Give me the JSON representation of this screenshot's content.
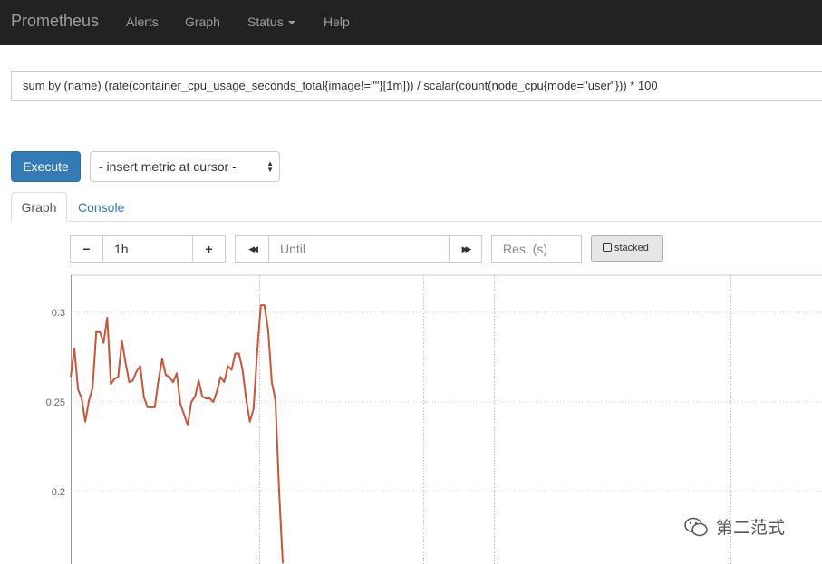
{
  "navbar": {
    "brand": "Prometheus",
    "items": [
      {
        "label": "Alerts"
      },
      {
        "label": "Graph"
      },
      {
        "label": "Status"
      },
      {
        "label": "Help"
      }
    ]
  },
  "query": {
    "expression": "sum by (name) (rate(container_cpu_usage_seconds_total{image!=\"\"}[1m])) / scalar(count(node_cpu{mode=\"user\"})) * 100"
  },
  "actions": {
    "execute_label": "Execute",
    "insert_metric_label": "- insert metric at cursor -"
  },
  "tabs": [
    {
      "label": "Graph",
      "active": true
    },
    {
      "label": "Console",
      "active": false
    }
  ],
  "controls": {
    "range_minus": "−",
    "range_value": "1h",
    "range_plus": "+",
    "back_icon": "◀◀",
    "until_placeholder": "Until",
    "forward_icon": "▶▶",
    "resolution_placeholder": "Res. (s)",
    "stacked_label": "stacked"
  },
  "colors": {
    "series": "#c8553a",
    "navbar_bg": "#222222",
    "primary": "#337ab7",
    "link": "#337ab7"
  },
  "chart_data": {
    "type": "line",
    "y_ticks": [
      "0.3",
      "0.25",
      "0.2"
    ],
    "ylim": [
      0.16,
      0.32
    ],
    "grid": true,
    "series": [
      {
        "values": [
          0.264,
          0.28,
          0.257,
          0.252,
          0.239,
          0.251,
          0.258,
          0.289,
          0.289,
          0.283,
          0.297,
          0.26,
          0.263,
          0.264,
          0.284,
          0.272,
          0.261,
          0.262,
          0.267,
          0.27,
          0.253,
          0.247,
          0.247,
          0.247,
          0.262,
          0.274,
          0.265,
          0.264,
          0.261,
          0.266,
          0.249,
          0.243,
          0.237,
          0.25,
          0.253,
          0.262,
          0.253,
          0.252,
          0.252,
          0.25,
          0.256,
          0.264,
          0.261,
          0.27,
          0.268,
          0.277,
          0.277,
          0.268,
          0.251,
          0.239,
          0.246,
          0.278,
          0.304,
          0.304,
          0.29,
          0.261,
          0.251,
          0.2,
          0.16
        ]
      }
    ]
  },
  "watermark": {
    "text": "第二范式"
  }
}
